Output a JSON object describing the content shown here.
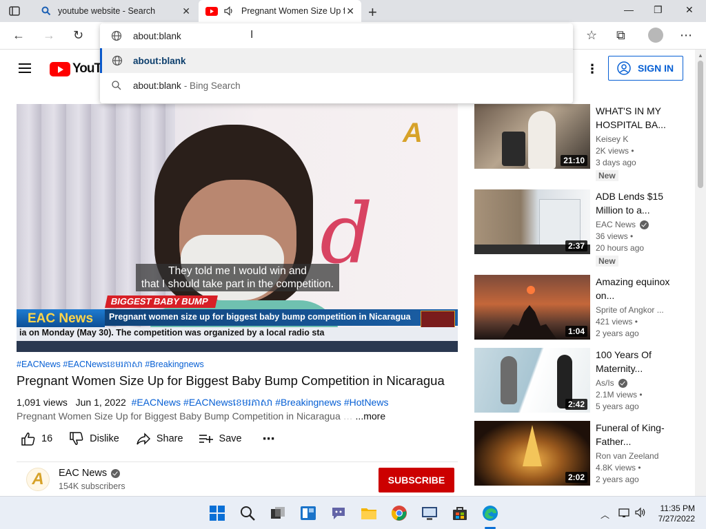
{
  "browser": {
    "tabs": [
      {
        "title": "youtube website - Search",
        "icon": "search-icon"
      },
      {
        "title": "Pregnant Women Size Up for Biggest Baby Bump Competition in Nicaragua",
        "icon": "youtube-icon",
        "audio": "speaker-icon"
      }
    ],
    "omnibox": {
      "value": "about:blank",
      "suggestions": [
        {
          "text": "about:blank",
          "hint": "",
          "icon": "globe-icon"
        },
        {
          "text": "about:blank",
          "hint": " - Bing Search",
          "icon": "search-icon"
        }
      ]
    }
  },
  "youtube": {
    "logo_text": "YouTube",
    "signin_label": "SIGN IN",
    "video": {
      "caption_line1": "They told me I would win and",
      "caption_line2": "that I should take part in the competition.",
      "chyron_top": "BIGGEST BABY BUMP",
      "chyron_brand": "EAC News",
      "chyron_main": "Pregnant women size up for biggest baby bump competition in Nicaragua",
      "ticker": "ia on Monday (May 30). The competition was organized by a local radio sta",
      "hashtags": "#EACNews #EACNewsខេមរភាសា #Breakingnews",
      "title": "Pregnant Women Size Up for Biggest Baby Bump Competition in Nicaragua",
      "views": "1,091 views",
      "date": "Jun 1, 2022",
      "tags": "#EACNews #EACNewsខេមរភាសា #Breakingnews #HotNews",
      "description": "Pregnant Women Size Up for Biggest Baby Bump Competition in Nicaragua",
      "more_label": "...more",
      "likes": "16",
      "dislike_label": "Dislike",
      "share_label": "Share",
      "save_label": "Save"
    },
    "channel": {
      "name": "EAC News",
      "subscribers": "154K subscribers",
      "subscribe_label": "SUBSCRIBE"
    },
    "recommendations": [
      {
        "title": "WHAT'S IN MY HOSPITAL BA...",
        "channel": "Keisey K",
        "views": "2K views •",
        "age": "3 days ago",
        "badge": "New",
        "duration": "21:10",
        "verified": false
      },
      {
        "title": "ADB Lends $15 Million to a...",
        "channel": "EAC News",
        "views": "36 views •",
        "age": "20 hours ago",
        "badge": "New",
        "duration": "2:37",
        "verified": true
      },
      {
        "title": "Amazing equinox on...",
        "channel": "Sprite of Angkor ...",
        "views": "421 views •",
        "age": "2 years ago",
        "badge": "",
        "duration": "1:04",
        "verified": false
      },
      {
        "title": "100 Years Of Maternity...",
        "channel": "As/Is",
        "views": "2.1M views •",
        "age": "5 years ago",
        "badge": "",
        "duration": "2:42",
        "verified": true
      },
      {
        "title": "Funeral of King-Father...",
        "channel": "Ron van Zeeland",
        "views": "4.8K views •",
        "age": "2 years ago",
        "badge": "",
        "duration": "2:02",
        "verified": false
      }
    ]
  },
  "taskbar": {
    "time": "11:35 PM",
    "date": "7/27/2022"
  }
}
